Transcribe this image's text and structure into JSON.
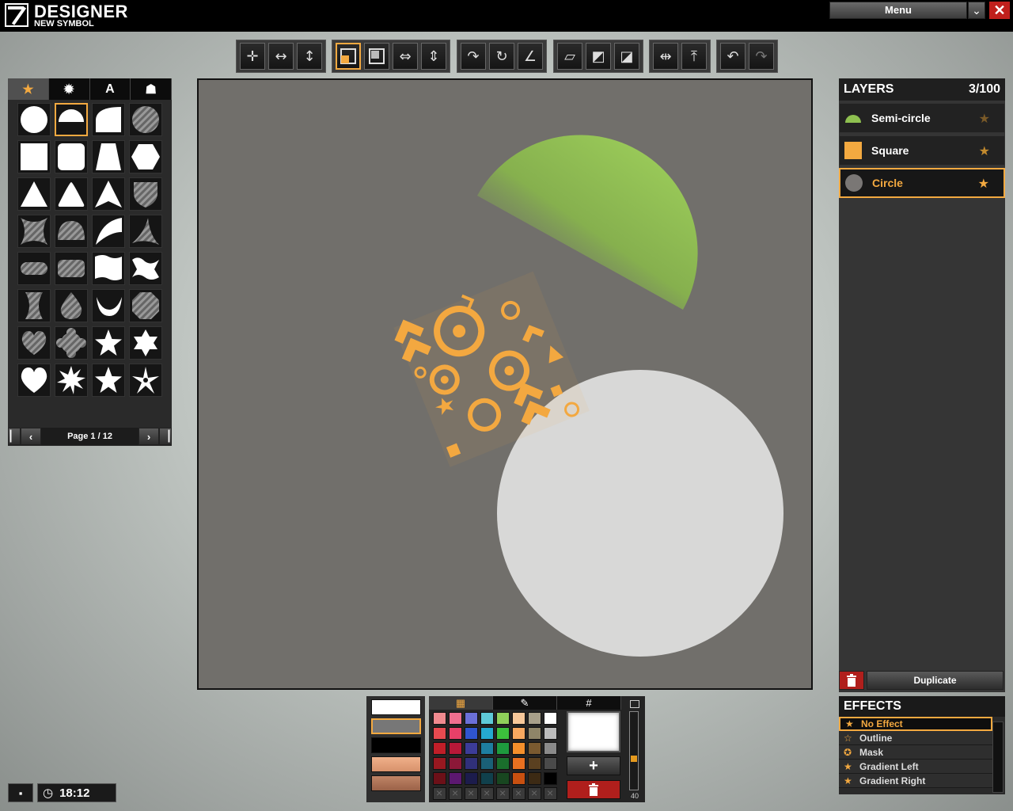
{
  "app": {
    "title": "DESIGNER",
    "subtitle": "NEW SYMBOL",
    "menu_label": "Menu"
  },
  "toolbar": {
    "groups": [
      [
        "move-icon",
        "move-horizontal-icon",
        "move-vertical-icon"
      ],
      [
        "scale-icon",
        "scale-corner-icon",
        "scale-horizontal-icon",
        "scale-vertical-icon"
      ],
      [
        "rotate-icon",
        "rotate-free-icon",
        "rotate-angle-icon"
      ],
      [
        "skew-icon",
        "skew-horizontal-icon",
        "skew-vertical-icon"
      ],
      [
        "flip-horizontal-icon",
        "flip-vertical-icon"
      ],
      [
        "undo-icon",
        "redo-icon"
      ]
    ]
  },
  "shape_panel": {
    "tabs": [
      "favorites-tab",
      "badges-tab",
      "A",
      "images-tab"
    ],
    "page_label": "Page 1 / 12"
  },
  "layers": {
    "title": "LAYERS",
    "count": "3/100",
    "items": [
      {
        "name": "Semi-circle",
        "color": "#8ec050"
      },
      {
        "name": "Square",
        "color": "#f3a940"
      },
      {
        "name": "Circle",
        "color": "#7a7775"
      }
    ],
    "duplicate_label": "Duplicate"
  },
  "effects": {
    "title": "EFFECTS",
    "items": [
      "No Effect",
      "Outline",
      "Mask",
      "Gradient Left",
      "Gradient Right"
    ]
  },
  "palette": {
    "tabs": [
      "palette-icon",
      "eyedropper-icon",
      "#"
    ],
    "colors": [
      "#f08a8f",
      "#f06f8f",
      "#6b70d8",
      "#5ecad8",
      "#8fd05a",
      "#f7c89a",
      "#a8a08a",
      "#ffffff",
      "#e84a50",
      "#e84068",
      "#2f55d0",
      "#25a9d0",
      "#3cbf3c",
      "#f7a860",
      "#8f8568",
      "#bcbcbc",
      "#c01e28",
      "#b81838",
      "#3c3c98",
      "#1e7ea0",
      "#1e9a3e",
      "#f58f2b",
      "#7a5a30",
      "#8a8a8a",
      "#981820",
      "#8c1838",
      "#30307a",
      "#1a6077",
      "#1a6e2c",
      "#e87020",
      "#5a4020",
      "#4a4a4a",
      "#6c1018",
      "#5c1870",
      "#1c1c4c",
      "#10404c",
      "#184620",
      "#c85010",
      "#3c2a14",
      "#000000"
    ],
    "empty_slots": 8,
    "opacity": 40
  },
  "swatches": [
    "#ffffff",
    "#777777",
    "#000000",
    "#e8a27e",
    "#b87a5e"
  ],
  "status": {
    "time": "18:12"
  }
}
